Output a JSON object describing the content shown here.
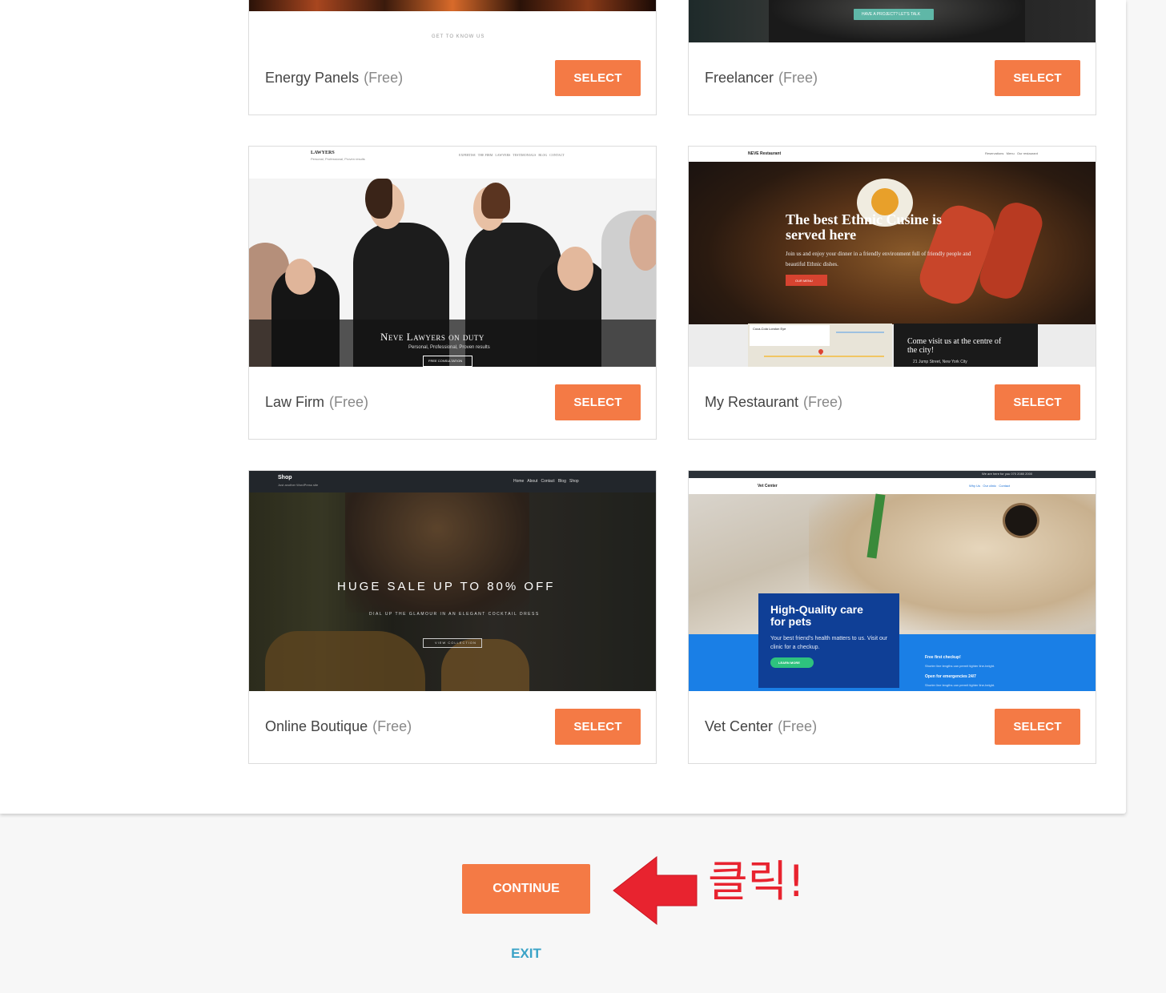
{
  "templates": [
    {
      "name": "Energy Panels",
      "price": "(Free)",
      "button": "SELECT",
      "preview_footer": "GET TO KNOW US"
    },
    {
      "name": "Freelancer",
      "price": "(Free)",
      "button": "SELECT",
      "preview_button": "HAVE A PROJECT? LET'S TALK"
    },
    {
      "name": "Law Firm",
      "price": "(Free)",
      "button": "SELECT",
      "preview": {
        "logo": "LAWYERS",
        "tagline": "Personal, Professional, Proven results",
        "nav": "EXPERTISE   THE FIRM   LAWYERS   TESTIMONIALS   BLOG   CONTACT",
        "headline": "Neve Lawyers on duty",
        "subheadline": "Personal, Professional, Proven results",
        "cta": "FREE CONSULTATION"
      }
    },
    {
      "name": "My Restaurant",
      "price": "(Free)",
      "button": "SELECT",
      "preview": {
        "logo": "NEVE Restaurant",
        "nav": "Reservations   Menu   Our restaurant",
        "headline": "The best Ethnic Cusine is served here",
        "text": "Join us and enjoy your dinner in a friendly environment full of friendly people and beautiful Ethnic dishes.",
        "cta": "OUR MENU",
        "visit": "Come visit us at the centre of the city!",
        "address": "21 Jump Street, New York City",
        "map_place": "Coca-Cola London Eye"
      }
    },
    {
      "name": "Online Boutique",
      "price": "(Free)",
      "button": "SELECT",
      "preview": {
        "logo": "Shop",
        "tagline": "Just another WordPress site",
        "nav": "Home   About   Contact   Blog   Shop",
        "headline": "HUGE SALE UP TO 80% OFF",
        "sub": "DIAL UP THE GLAMOUR IN AN ELEGANT COCKTAIL DRESS",
        "cta": "VIEW COLLECTION"
      }
    },
    {
      "name": "Vet Center",
      "price": "(Free)",
      "button": "SELECT",
      "preview": {
        "topbar": "We are here for you 070 2080 2000",
        "logo": "Vet Center",
        "nav": "Why Us   Our clinic   Contact",
        "headline": "High-Quality care for pets",
        "text": "Your best friend's health matters to us. Visit our clinic for a checkup.",
        "cta": "LEARN MORE",
        "feature1": "Free first checkup!",
        "feature2": "Open for emergencies 24/7",
        "feature_text": "Shorter line lengths can permit tighter line-height."
      }
    }
  ],
  "actions": {
    "continue": "CONTINUE",
    "exit": "EXIT"
  },
  "annotation": "클릭!",
  "colors": {
    "accent": "#f47a45",
    "link": "#3aa3c7",
    "annotation": "#e8232f"
  }
}
